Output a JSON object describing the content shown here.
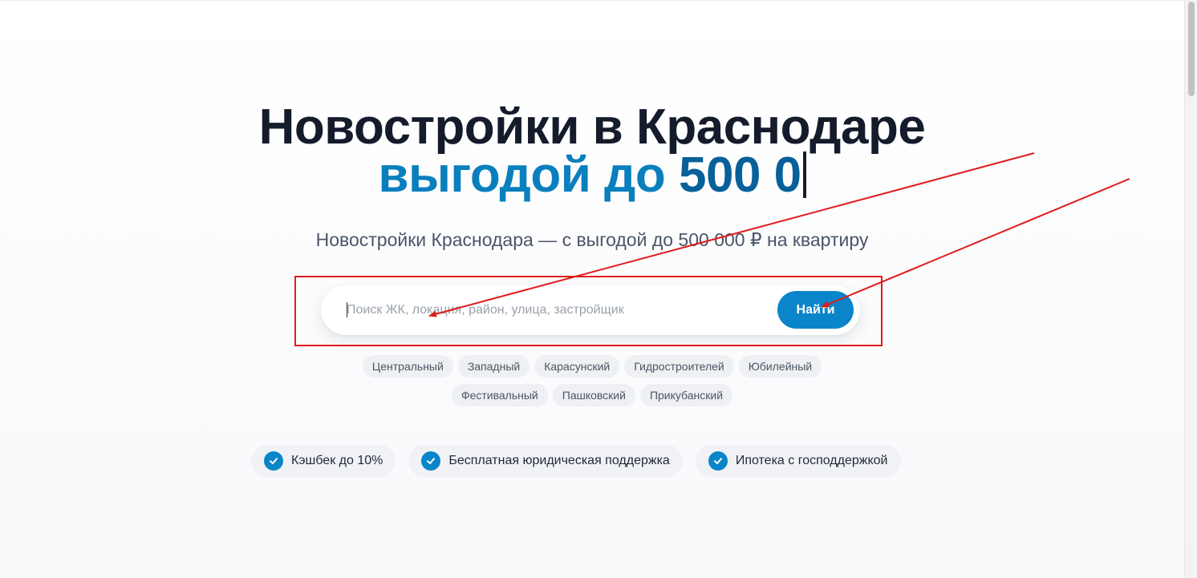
{
  "hero": {
    "title": "Новостройки в Краснодаре",
    "accent_part1": "выгодой до ",
    "accent_part2": "500 0",
    "subtitle": "Новостройки Краснодара — с выгодой до 500 000 ₽ на квартиру"
  },
  "search": {
    "placeholder": "Поиск ЖК, локация, район, улица, застройщик",
    "value": "",
    "button_label": "Найти"
  },
  "districts": {
    "row1": [
      "Центральный",
      "Западный",
      "Карасунский",
      "Гидростроителей",
      "Юбилейный"
    ],
    "row2": [
      "Фестивальный",
      "Пашковский",
      "Прикубанский"
    ]
  },
  "benefits": [
    {
      "label": "Кэшбек до 10%",
      "icon": "check-icon"
    },
    {
      "label": "Бесплатная юридическая поддержка",
      "icon": "check-icon"
    },
    {
      "label": "Ипотека с господдержкой",
      "icon": "check-icon"
    }
  ],
  "colors": {
    "title": "#141b2b",
    "accent": "#0a7fbd",
    "button": "#0a85c9",
    "annotation": "#e01b1b"
  }
}
